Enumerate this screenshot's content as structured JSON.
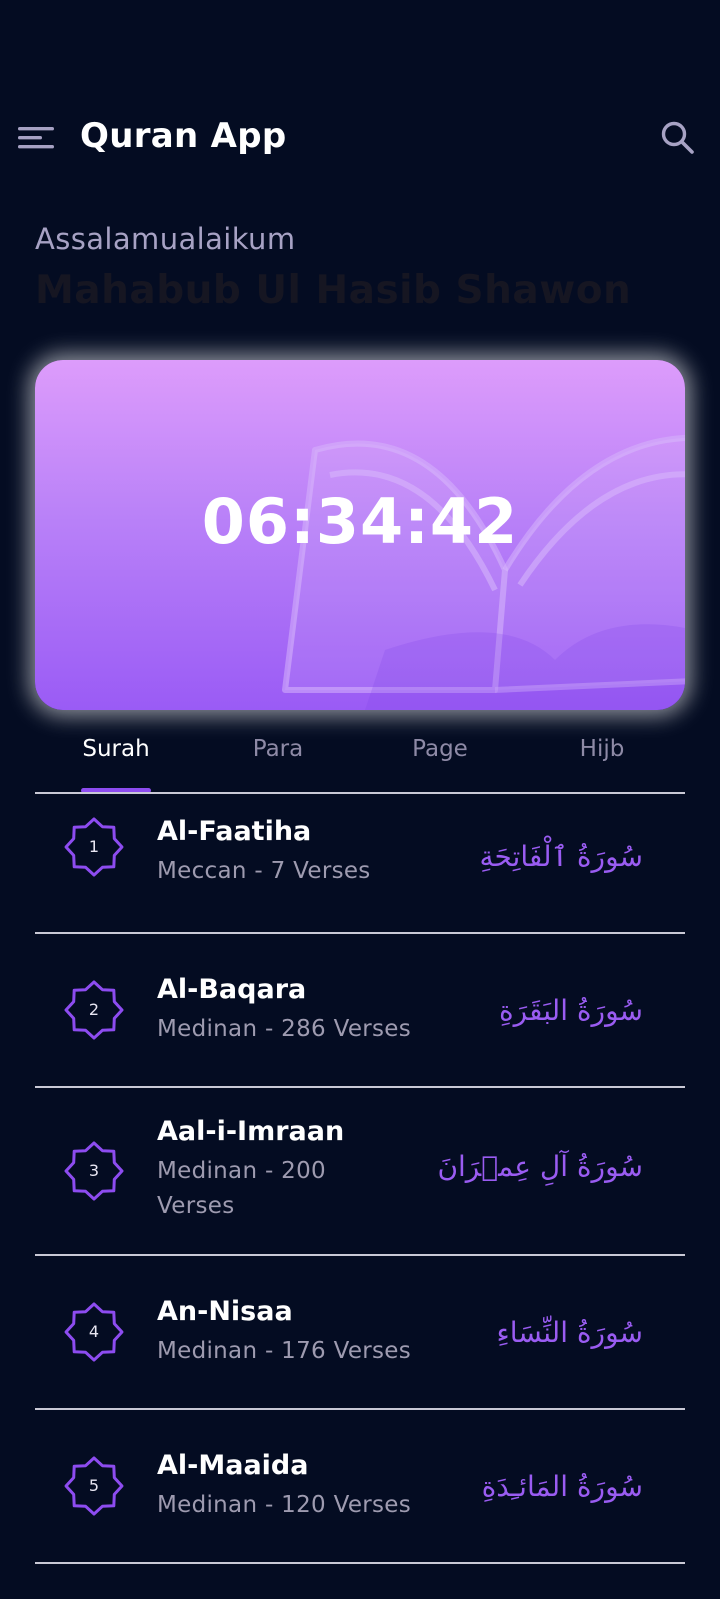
{
  "header": {
    "title": "Quran App",
    "menu_icon": "hamburger-menu-icon",
    "search_icon": "search-icon"
  },
  "greeting": {
    "salutation": "Assalamualaikum",
    "user_name": "Mahabub Ul Hasib Shawon"
  },
  "timer_card": {
    "time": "06:34:42",
    "background_icon": "open-quran-book-icon",
    "gradient_top": "#dd9cfb",
    "gradient_bottom": "#9a5bf5"
  },
  "tabs": [
    {
      "label": "Surah",
      "active": true
    },
    {
      "label": "Para",
      "active": false
    },
    {
      "label": "Page",
      "active": false
    },
    {
      "label": "Hijb",
      "active": false
    }
  ],
  "accent_color": "#8d4cf0",
  "surahs": [
    {
      "number": "1",
      "name": "Al-Faatiha",
      "meta": "Meccan - 7 Verses",
      "arabic": "سُورَةُ ٱلْفَاتِحَةِ"
    },
    {
      "number": "2",
      "name": "Al-Baqara",
      "meta": "Medinan - 286 Verses",
      "arabic": "سُورَةُ البَقَرَةِ"
    },
    {
      "number": "3",
      "name": "Aal-i-Imraan",
      "meta": "Medinan - 200 Verses",
      "arabic": "سُورَةُ آلِ عِمۡرَانَ"
    },
    {
      "number": "4",
      "name": "An-Nisaa",
      "meta": "Medinan - 176 Verses",
      "arabic": "سُورَةُ النِّسَاءِ"
    },
    {
      "number": "5",
      "name": "Al-Maaida",
      "meta": "Medinan - 120 Verses",
      "arabic": "سُورَةُ المَائـِدَةِ"
    }
  ]
}
